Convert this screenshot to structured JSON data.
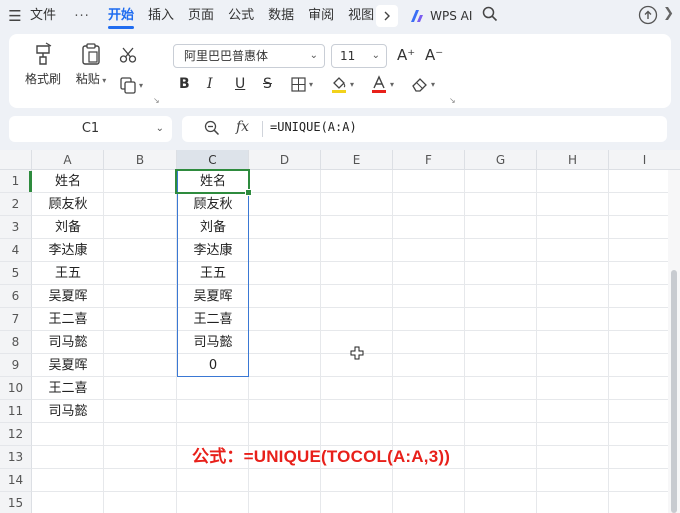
{
  "menu": {
    "file": "文件",
    "tabs": [
      "开始",
      "插入",
      "页面",
      "公式",
      "数据",
      "审阅",
      "视图"
    ],
    "active_tab": "开始",
    "ai": "WPS AI"
  },
  "ribbon": {
    "format_painter": "格式刷",
    "paste": "粘贴",
    "font_name": "阿里巴巴普惠体",
    "font_size": "11",
    "increase_font": "A⁺",
    "decrease_font": "A⁻",
    "bold": "B",
    "italic": "I",
    "underline": "U"
  },
  "formula_bar": {
    "name_box": "C1",
    "fx": "fx",
    "formula": "=UNIQUE(A:A)"
  },
  "sheet": {
    "columns": [
      "A",
      "B",
      "C",
      "D",
      "E",
      "F",
      "G",
      "H",
      "I"
    ],
    "rows": [
      "1",
      "2",
      "3",
      "4",
      "5",
      "6",
      "7",
      "8",
      "9",
      "10",
      "11",
      "12",
      "13",
      "14",
      "15"
    ],
    "col_a": [
      "姓名",
      "顾友秋",
      "刘备",
      "李达康",
      "王五",
      "吴夏晖",
      "王二喜",
      "司马懿",
      "吴夏晖",
      "王二喜",
      "司马懿"
    ],
    "col_c": [
      "姓名",
      "顾友秋",
      "刘备",
      "李达康",
      "王五",
      "吴夏晖",
      "王二喜",
      "司马懿",
      "0"
    ],
    "annotation": "公式：=UNIQUE(TOCOL(A:A,3))"
  },
  "colors": {
    "accent": "#1f6cf0",
    "active_cell": "#2e8b3e",
    "spill_border": "#3a78d4",
    "annotation": "#e8201a"
  }
}
